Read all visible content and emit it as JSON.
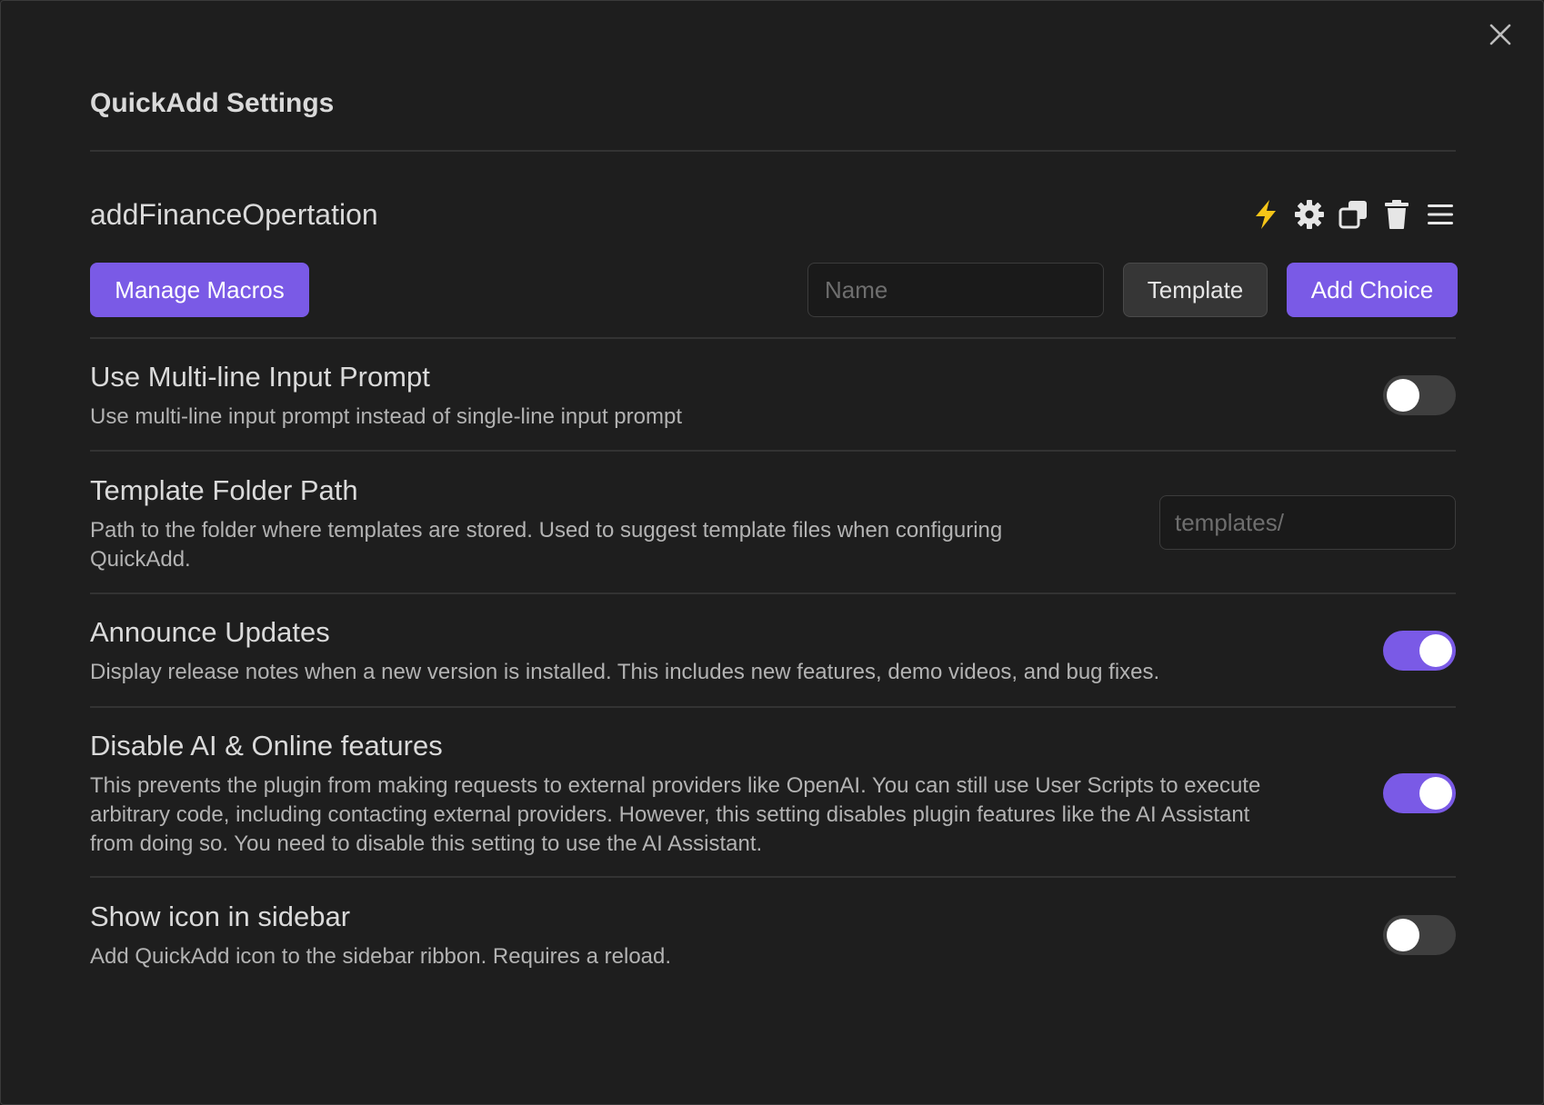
{
  "page": {
    "title": "QuickAdd Settings"
  },
  "choice": {
    "name": "addFinanceOpertation",
    "icons": [
      "lightning-icon",
      "gear-icon",
      "duplicate-icon",
      "trash-icon",
      "drag-handle-icon"
    ]
  },
  "actions": {
    "manage_macros_label": "Manage Macros",
    "name_placeholder": "Name",
    "name_value": "",
    "template_label": "Template",
    "add_choice_label": "Add Choice"
  },
  "settings": [
    {
      "name": "Use Multi-line Input Prompt",
      "description": "Use multi-line input prompt instead of single-line input prompt",
      "control": "toggle",
      "enabled": false
    },
    {
      "name": "Template Folder Path",
      "description_line1": "Path to the folder where templates are stored. Used to suggest template files when configuring",
      "description_line2": "QuickAdd.",
      "control": "text",
      "placeholder": "templates/",
      "value": ""
    },
    {
      "name": "Announce Updates",
      "description": "Display release notes when a new version is installed. This includes new features, demo videos, and bug fixes.",
      "control": "toggle",
      "enabled": true
    },
    {
      "name": "Disable AI & Online features",
      "description_line1": "This prevents the plugin from making requests to external providers like OpenAI. You can still use User Scripts to execute",
      "description_line2": "arbitrary code, including contacting external providers. However, this setting disables plugin features like the AI Assistant",
      "description_line3": "from doing so. You need to disable this setting to use the AI Assistant.",
      "control": "toggle",
      "enabled": true
    },
    {
      "name": "Show icon in sidebar",
      "description": "Add QuickAdd icon to the sidebar ribbon. Requires a reload.",
      "control": "toggle",
      "enabled": false
    }
  ],
  "colors": {
    "accent": "#7a5ae6",
    "lightning": "#f5c518",
    "background": "#1e1e1e",
    "text": "#dadada",
    "muted_text": "#b3b3b3"
  }
}
